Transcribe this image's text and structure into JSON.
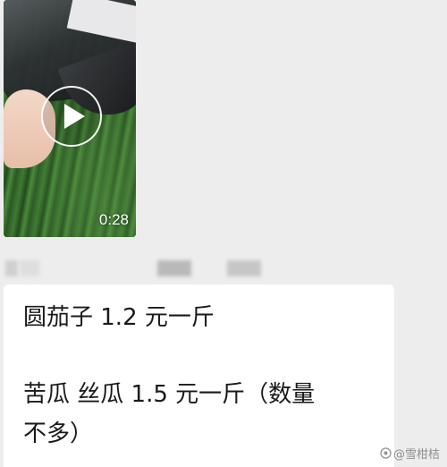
{
  "video": {
    "duration": "0:28",
    "play_icon": "play-icon"
  },
  "text_message": {
    "line1": "圆茄子   1.2 元一斤",
    "line2": "苦瓜   丝瓜   1.5 元一斤（数量",
    "line3": "不多）"
  },
  "watermark": {
    "text": "@雪柑桔",
    "logo_icon": "platform-logo-icon"
  },
  "colors": {
    "background": "#ededed",
    "bubble": "#ffffff",
    "text": "#1a1a1a"
  }
}
